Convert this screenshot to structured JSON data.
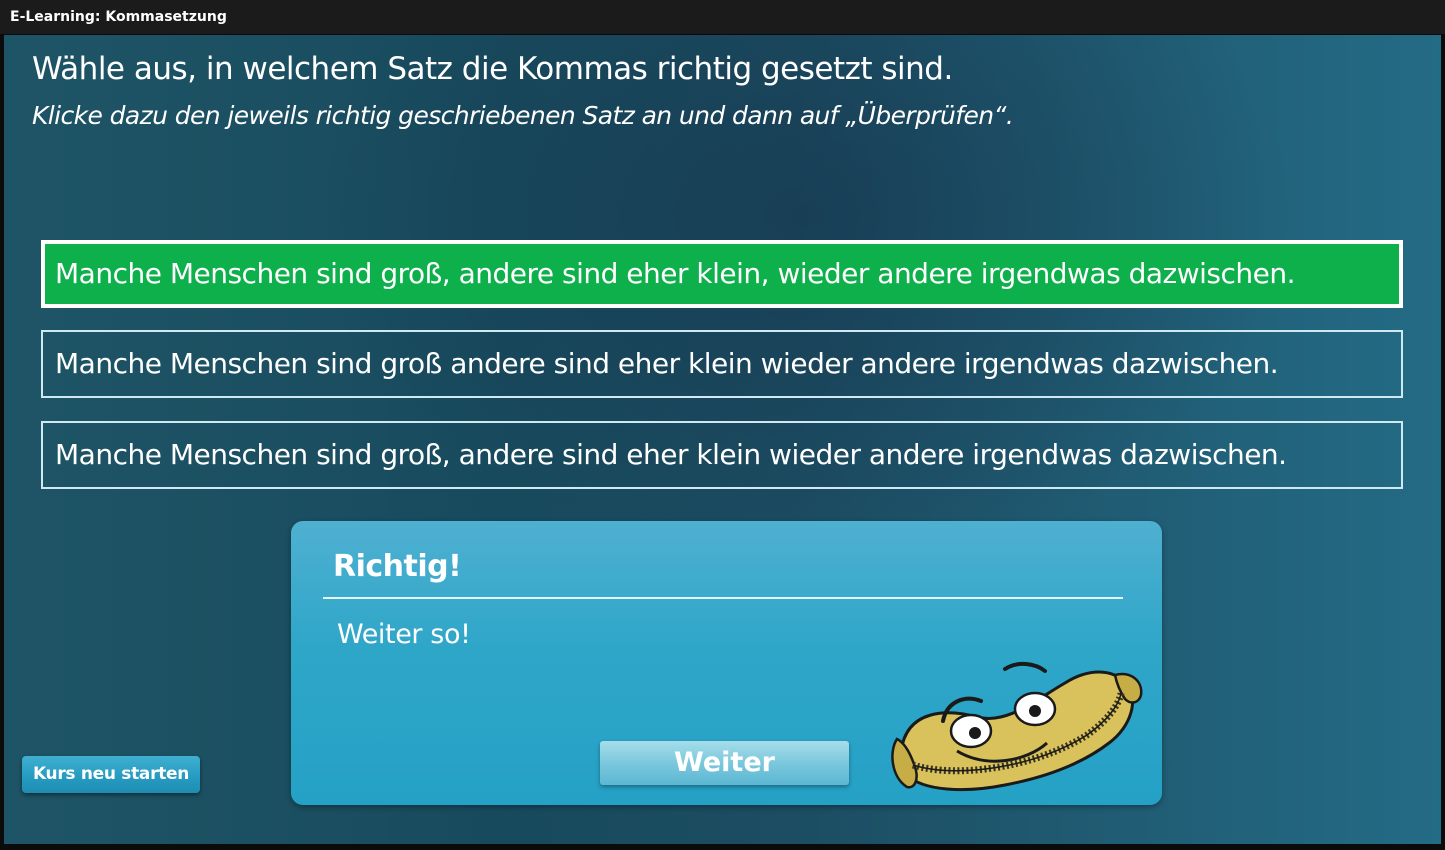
{
  "window": {
    "title": "E-Learning: Kommasetzung"
  },
  "task": {
    "instruction": "Wähle aus, in welchem Satz die Kommas richtig gesetzt sind.",
    "hint": "Klicke dazu den jeweils richtig geschriebenen Satz an und dann auf „Überprüfen“."
  },
  "options": [
    {
      "text": "Manche Menschen sind groß, andere sind eher klein, wieder andere irgendwas dazwischen.",
      "state": "selected-correct"
    },
    {
      "text": "Manche Menschen sind groß andere sind eher klein wieder andere irgendwas dazwischen.",
      "state": "default"
    },
    {
      "text": "Manche Menschen sind groß, andere sind eher klein wieder andere irgendwas dazwischen.",
      "state": "default"
    }
  ],
  "feedback": {
    "title": "Richtig!",
    "message": "Weiter so!",
    "continue_label": "Weiter",
    "mascot_icon": "zipper-mascot-icon"
  },
  "footer": {
    "restart_label": "Kurs neu starten"
  },
  "colors": {
    "correct": "#0db04b",
    "panel": "#2ea6c8",
    "background": "#1c4d62"
  }
}
